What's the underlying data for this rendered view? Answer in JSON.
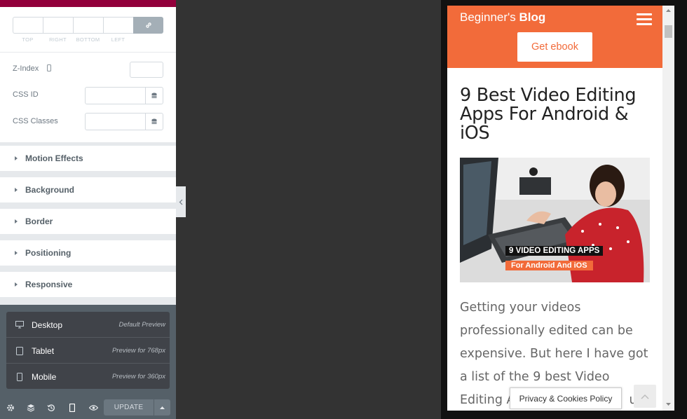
{
  "panel": {
    "dimension_labels": [
      "TOP",
      "RIGHT",
      "BOTTOM",
      "LEFT"
    ],
    "z_index_label": "Z-Index",
    "css_id_label": "CSS ID",
    "css_classes_label": "CSS Classes",
    "sections": [
      "Motion Effects",
      "Background",
      "Border",
      "Positioning",
      "Responsive"
    ],
    "responsive_modes": [
      {
        "label": "Desktop",
        "desc": "Default Preview",
        "icon": "desktop-icon"
      },
      {
        "label": "Tablet",
        "desc": "Preview for 768px",
        "icon": "tablet-icon"
      },
      {
        "label": "Mobile",
        "desc": "Preview for 360px",
        "icon": "mobile-icon"
      }
    ],
    "footer": {
      "update_label": "UPDATE",
      "icons": [
        "settings-icon",
        "navigator-icon",
        "history-icon",
        "responsive-mode-icon",
        "preview-icon"
      ]
    }
  },
  "preview": {
    "site_name_light": "Beginner's",
    "site_name_bold": "Blog",
    "cta_label": "Get ebook",
    "post_title": "9 Best Video Editing Apps For Android & iOS",
    "hero_caption_line1": "9 VIDEO EDITING APPS",
    "hero_caption_line2": "For Android And iOS",
    "body_lines": [
      "Getting your videos",
      "professionally edited can be",
      "expensive. But here I have got",
      "a list of the 9 best Video",
      "Editing A"
    ],
    "body_hidden_tail": "u to",
    "privacy_label": "Privacy & Cookies Policy"
  },
  "colors": {
    "brand_accent": "#92003b",
    "site_orange": "#f26b3a",
    "panel_dark": "#556068"
  }
}
